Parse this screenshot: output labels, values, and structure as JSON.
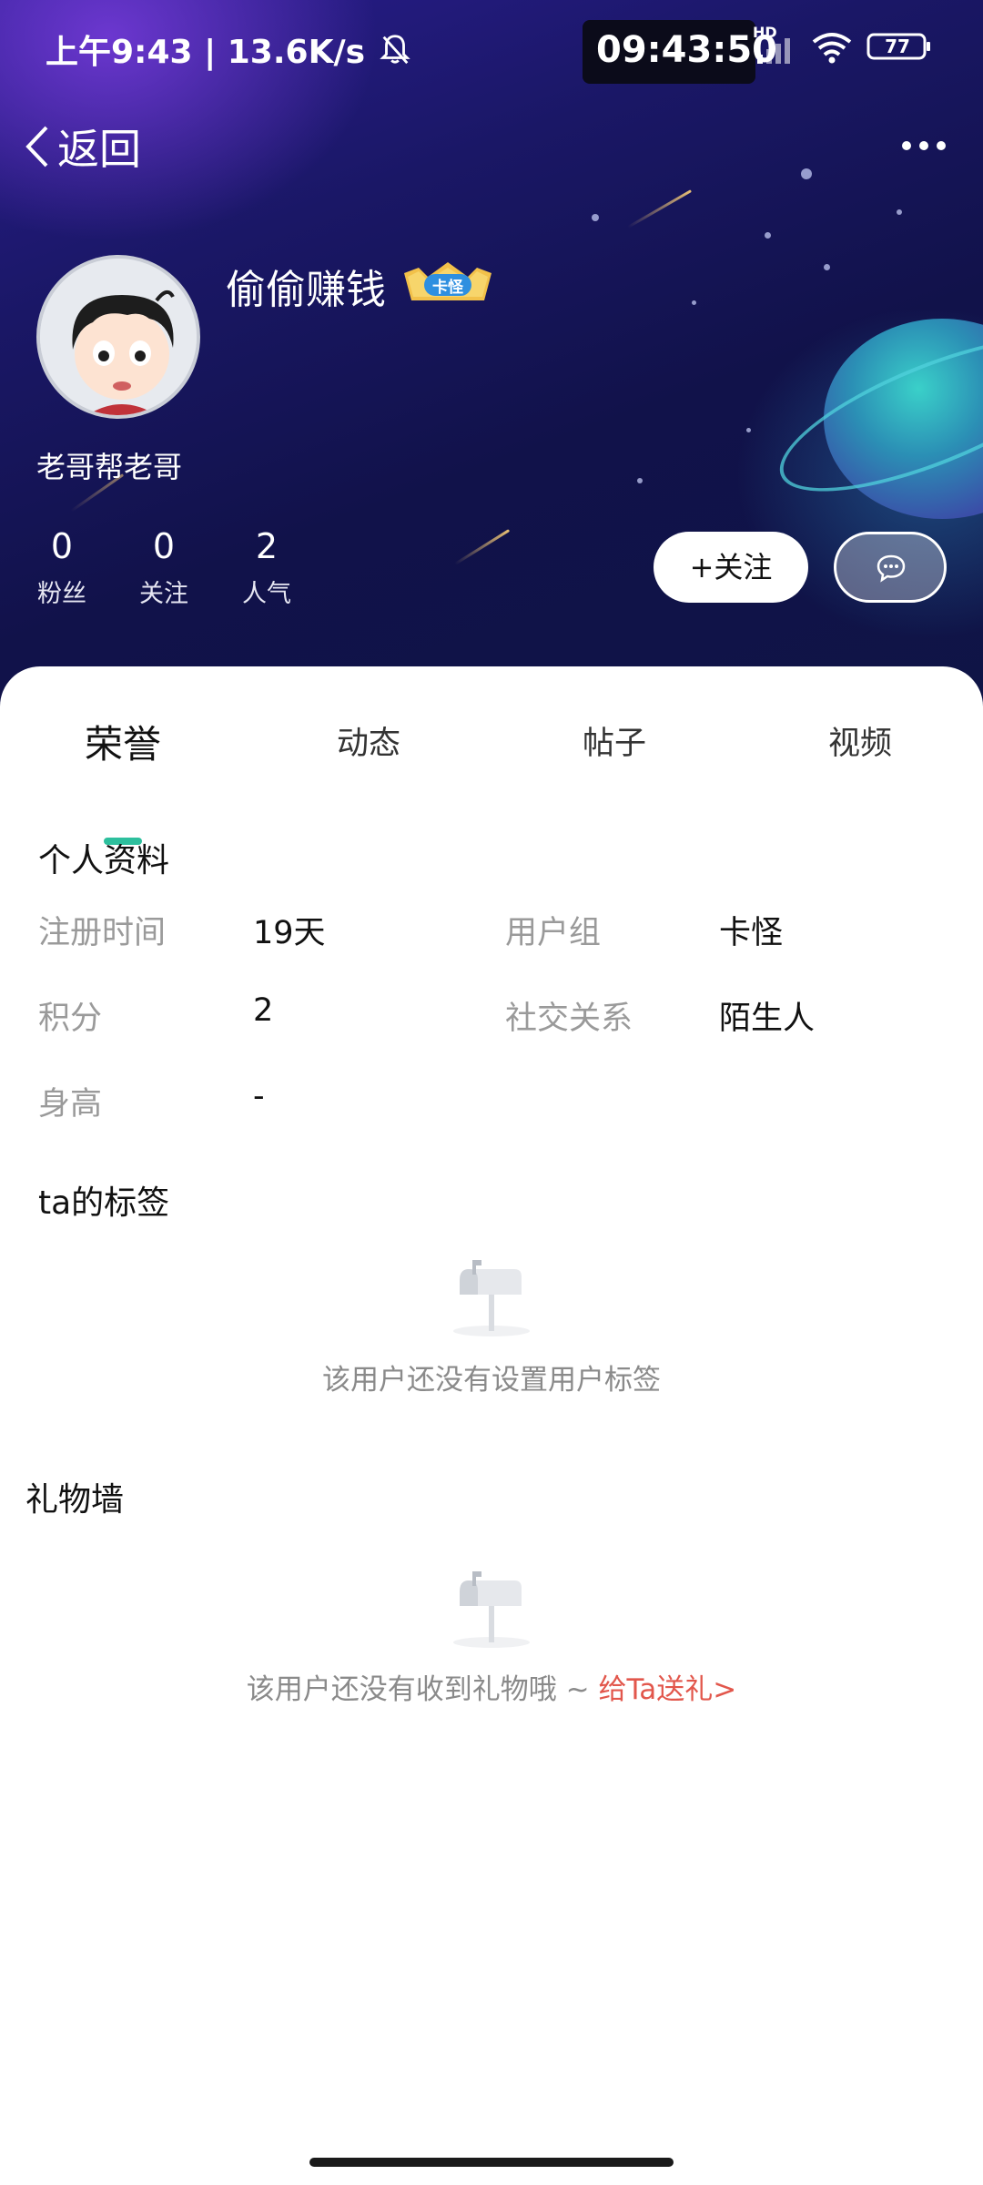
{
  "status_bar": {
    "left_text": "上午9:43 | 13.6K/s",
    "clock": "09:43:50",
    "network": "HD",
    "battery": "77"
  },
  "nav": {
    "back_label": "返回"
  },
  "profile": {
    "username": "偷偷赚钱",
    "badge": "卡怪",
    "signature": "老哥帮老哥",
    "stats": [
      {
        "value": "0",
        "label": "粉丝"
      },
      {
        "value": "0",
        "label": "关注"
      },
      {
        "value": "2",
        "label": "人气"
      }
    ],
    "follow_label": "+关注"
  },
  "tabs": [
    "荣誉",
    "动态",
    "帖子",
    "视频"
  ],
  "personal_info": {
    "title": "个人资料",
    "fields": [
      {
        "label": "注册时间",
        "value": "19天"
      },
      {
        "label": "用户组",
        "value": "卡怪"
      },
      {
        "label": "积分",
        "value": "2"
      },
      {
        "label": "社交关系",
        "value": "陌生人"
      },
      {
        "label": "身高",
        "value": "-"
      }
    ]
  },
  "tags": {
    "title": "ta的标签",
    "empty_text": "该用户还没有设置用户标签"
  },
  "gifts": {
    "title": "礼物墙",
    "empty_text": "该用户还没有收到礼物哦 ~ ",
    "link": "给Ta送礼>"
  },
  "colors": {
    "accent": "#2dbf9d",
    "link": "#e2574c"
  }
}
